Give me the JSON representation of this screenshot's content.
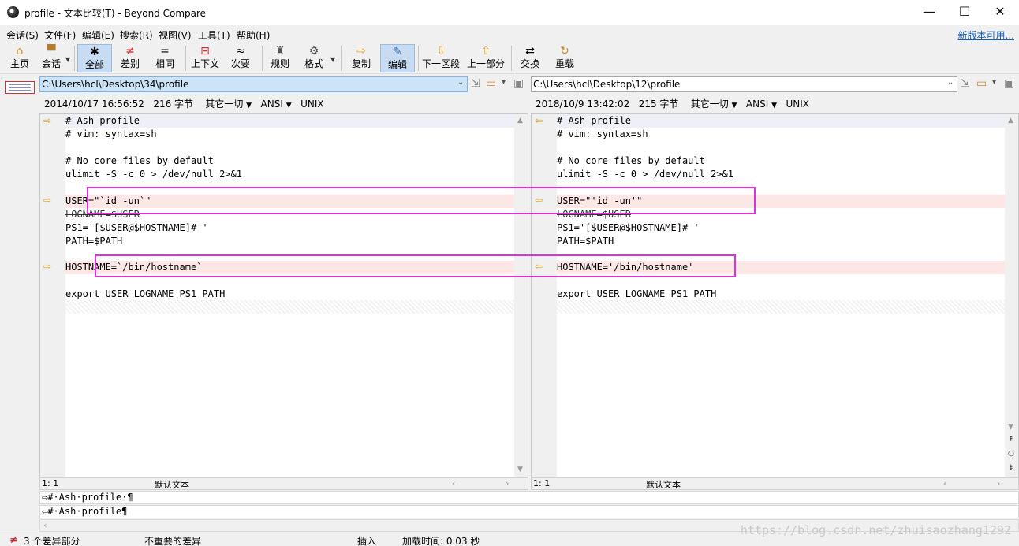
{
  "window": {
    "title": "profile - 文本比较(T) - Beyond Compare"
  },
  "menu": {
    "items": [
      "会话(S)",
      "文件(F)",
      "编辑(E)",
      "搜索(R)",
      "视图(V)",
      "工具(T)",
      "帮助(H)"
    ],
    "new_version": "新版本可用..."
  },
  "toolbar": {
    "home": "主页",
    "session": "会话",
    "all": "全部",
    "diffs": "差别",
    "same": "相同",
    "context": "上下文",
    "minor": "次要",
    "rules": "规则",
    "format": "格式",
    "copy": "复制",
    "edit": "编辑",
    "next_section": "下一区段",
    "prev_section": "上一部分",
    "swap": "交换",
    "reload": "重载"
  },
  "left": {
    "path": "C:\\Users\\hcl\\Desktop\\34\\profile",
    "date": "2014/10/17 16:56:52",
    "size": "216 字节",
    "other": "其它一切",
    "encoding": "ANSI",
    "lineend": "UNIX",
    "lines": [
      "# Ash profile",
      "# vim: syntax=sh",
      "",
      "# No core files by default",
      "ulimit -S -c 0 > /dev/null 2>&1",
      "",
      "USER=\"`id -un`\"",
      "LOGNAME=$USER",
      "PS1='[$USER@$HOSTNAME]# '",
      "PATH=$PATH",
      "",
      "HOSTNAME=`/bin/hostname`",
      "",
      "export USER LOGNAME PS1 PATH"
    ],
    "status_pos": "1: 1",
    "status_text": "默认文本"
  },
  "right": {
    "path": "C:\\Users\\hcl\\Desktop\\12\\profile",
    "date": "2018/10/9 13:42:02",
    "size": "215 字节",
    "other": "其它一切",
    "encoding": "ANSI",
    "lineend": "UNIX",
    "lines": [
      "# Ash profile",
      "# vim: syntax=sh",
      "",
      "# No core files by default",
      "ulimit -S -c 0 > /dev/null 2>&1",
      "",
      "USER=\"'id -un'\"",
      "LOGNAME=$USER",
      "PS1='[$USER@$HOSTNAME]# '",
      "PATH=$PATH",
      "",
      "HOSTNAME='/bin/hostname'",
      "",
      "export USER LOGNAME PS1 PATH"
    ],
    "status_pos": "1: 1",
    "status_text": "默认文本"
  },
  "detail": {
    "left_line": "⇨#·Ash·profile·¶",
    "right_line": "⇦#·Ash·profile¶"
  },
  "statusbar": {
    "diff_count": "3 个差异部分",
    "unimportant": "不重要的差异",
    "insert": "插入",
    "load_time": "加载时间: 0.03 秒"
  },
  "watermark": "https://blog.csdn.net/zhuisaozhang1292",
  "colors": {
    "diff_bg": "#fde6e6",
    "highlight": "#e02fe0",
    "marker": "#e3a21a"
  }
}
